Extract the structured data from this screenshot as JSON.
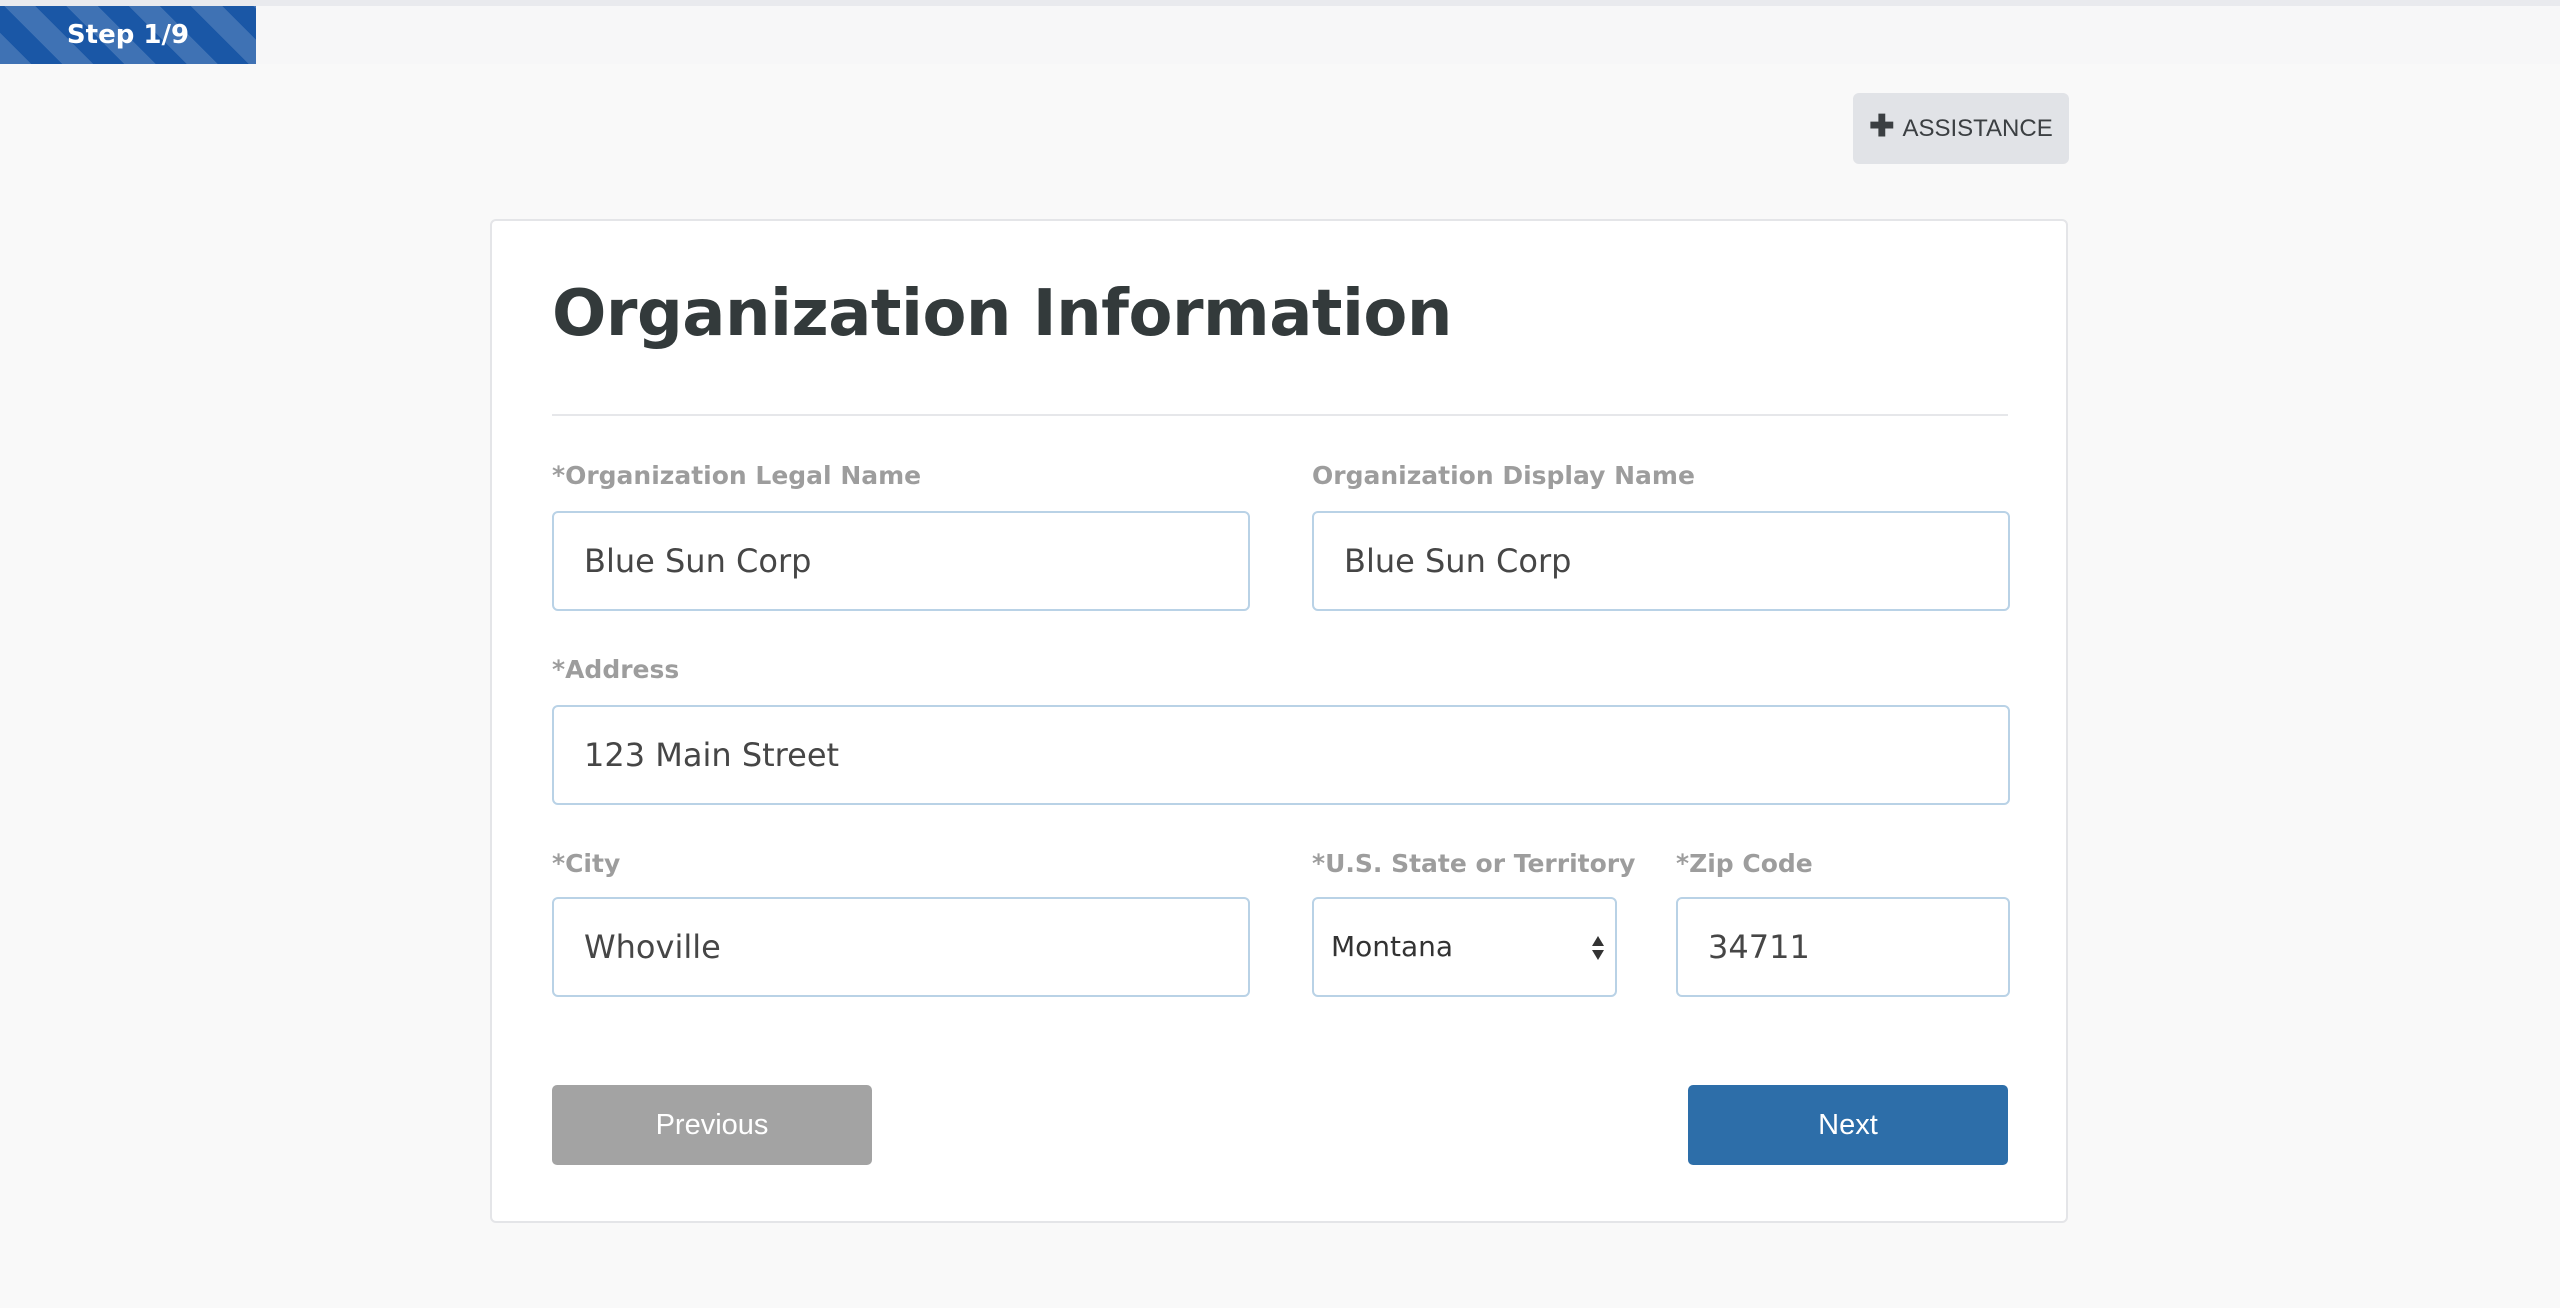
{
  "progress": {
    "step_label": "Step 1/9",
    "current": 1,
    "total": 9,
    "fill_fraction": 0.1,
    "color": "#1a57a6"
  },
  "assistance": {
    "icon": "plus-icon",
    "label": "ASSISTANCE"
  },
  "form": {
    "title": "Organization Information",
    "fields": {
      "legal_name": {
        "label": "*Organization Legal Name",
        "value": "Blue Sun Corp"
      },
      "display_name": {
        "label": "Organization Display Name",
        "value": "Blue Sun Corp"
      },
      "address": {
        "label": "*Address",
        "value": "123 Main Street"
      },
      "city": {
        "label": "*City",
        "value": "Whoville"
      },
      "state": {
        "label": "*U.S. State or Territory",
        "value": "Montana"
      },
      "zip": {
        "label": "*Zip Code",
        "value": "34711"
      }
    },
    "buttons": {
      "previous": "Previous",
      "next": "Next"
    }
  },
  "colors": {
    "primary": "#2d6ea9",
    "secondary_button": "#a3a3a3",
    "field_border": "#b9d2e6",
    "label": "#9d9d9d",
    "title": "#333a3b"
  }
}
